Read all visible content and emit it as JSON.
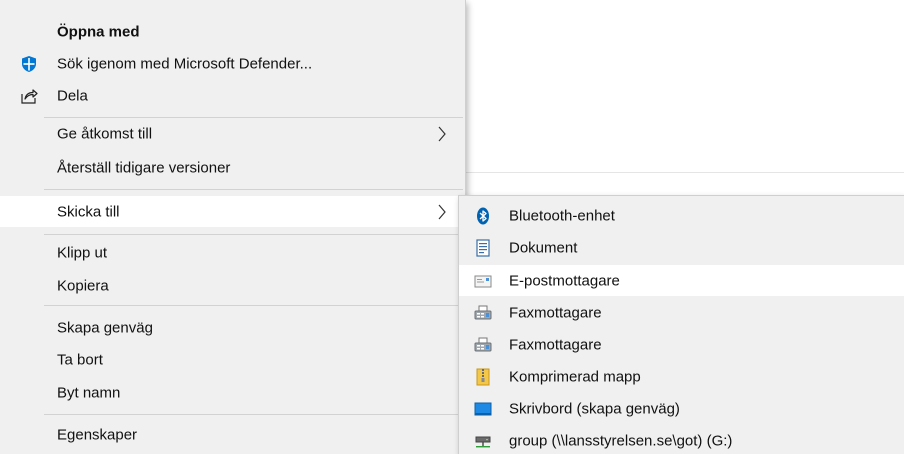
{
  "context_menu": {
    "items": {
      "open_with": "Öppna med",
      "scan_defender": "Sök igenom med Microsoft Defender...",
      "share": "Dela",
      "give_access": "Ge åtkomst till",
      "restore_versions": "Återställ tidigare versioner",
      "send_to": "Skicka till",
      "cut": "Klipp ut",
      "copy": "Kopiera",
      "create_shortcut": "Skapa genväg",
      "delete": "Ta bort",
      "rename": "Byt namn",
      "properties": "Egenskaper"
    },
    "icons": {
      "scan_defender": "defender-shield-icon",
      "share": "share-icon",
      "give_access": "chevron-right-icon",
      "send_to": "chevron-right-icon"
    },
    "highlighted": "Skicka till"
  },
  "send_to_submenu": {
    "items": [
      {
        "label": "Bluetooth-enhet",
        "icon": "bluetooth-icon"
      },
      {
        "label": "Dokument",
        "icon": "document-icon"
      },
      {
        "label": "E-postmottagare",
        "icon": "mail-recipient-icon"
      },
      {
        "label": "Faxmottagare",
        "icon": "fax-icon"
      },
      {
        "label": "Faxmottagare",
        "icon": "fax-icon"
      },
      {
        "label": "Komprimerad mapp",
        "icon": "zip-folder-icon"
      },
      {
        "label": "Skrivbord (skapa genväg)",
        "icon": "desktop-icon"
      },
      {
        "label": "group (\\\\lansstyrelsen.se\\got) (G:)",
        "icon": "network-drive-icon"
      }
    ],
    "highlighted": "E-postmottagare"
  },
  "colors": {
    "menu_background": "#f0f0f0",
    "highlight": "#ffffff",
    "defender_blue": "#0078d4",
    "bluetooth_blue": "#0063b1"
  }
}
